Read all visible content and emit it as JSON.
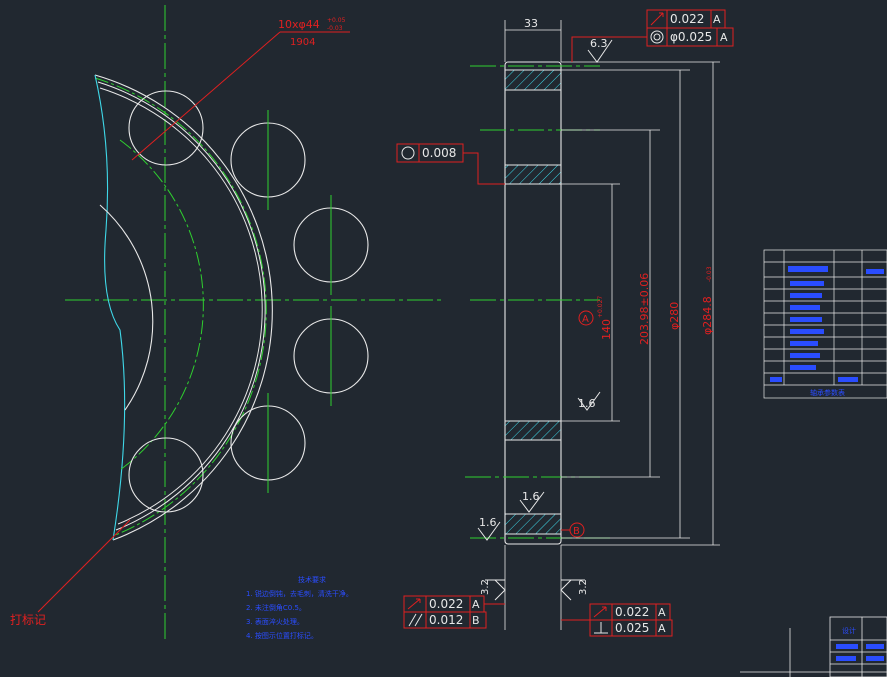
{
  "colors": {
    "background": "#212830",
    "outline": "#e8e8e8",
    "centerline": "#2fd02f",
    "dimension": "#e02020",
    "edge_highlight": "#3fd8e8",
    "notes": "#2a4dff"
  },
  "front_view": {
    "hole_callout_top": "10xφ44",
    "hole_callout_sup": "+0.05",
    "hole_callout_sub": "-0.03",
    "hole_callout_bottom": "1904",
    "mark_label": "打标记"
  },
  "side_view": {
    "width_dim": "33",
    "roughness_top": "6.3",
    "roughness_mid": "1.6",
    "roughness_face": "1.6",
    "roughness_left": "1.6",
    "roughness_bottom_left": "3.2",
    "roughness_bottom_right": "3.2",
    "datum_a": "A",
    "datum_b": "B",
    "dia_140": "140",
    "dia_140_tol": "+0.027",
    "dia_203": "203.98±0.06",
    "dia_280": "φ280",
    "dia_284": "φ284.8",
    "dia_284_tol": "-0.03"
  },
  "frames": {
    "top_runout_value": "0.022",
    "top_runout_datum": "A",
    "top_coax_value": "φ0.025",
    "top_coax_datum": "A",
    "roundness_value": "0.008",
    "bl_runout_value": "0.022",
    "bl_runout_datum": "A",
    "bl_parallel_value": "0.012",
    "bl_parallel_datum": "B",
    "br_runout_value": "0.022",
    "br_runout_datum": "A",
    "br_perp_value": "0.025",
    "br_perp_datum": "A"
  },
  "notes": {
    "title": "技术要求",
    "lines": [
      "1. 锐边倒钝，去毛刺，清洗干净。",
      "2. 未注倒角C0.5。",
      "3. 表面淬火处理。",
      "4. 按图示位置打标记。"
    ]
  },
  "param_table_title": "轴承参数表",
  "title_block_label": "设计"
}
